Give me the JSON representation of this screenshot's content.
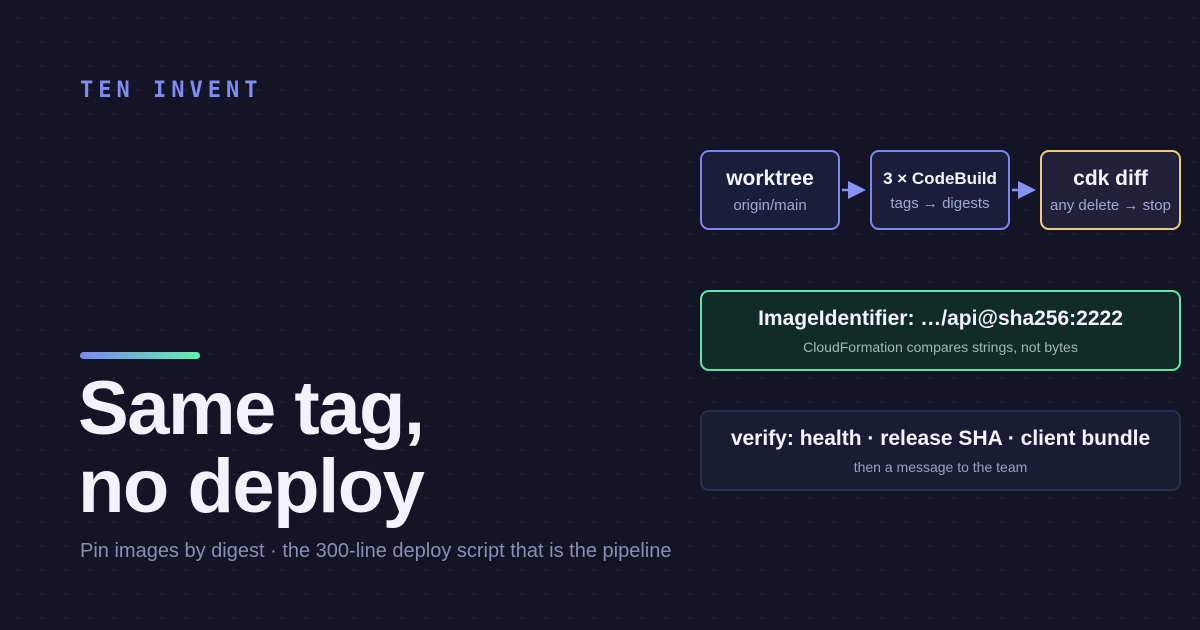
{
  "brand": "TEN INVENT",
  "headline": {
    "line1": "Same tag,",
    "line2": "no deploy"
  },
  "subtitle": "Pin images by digest · the 300-line deploy script that is the pipeline",
  "pipeline": {
    "nodes": [
      {
        "title": "worktree",
        "sub": "origin/main"
      },
      {
        "title": "3 × CodeBuild",
        "sub": "tags → digests"
      },
      {
        "title": "cdk diff",
        "sub": "any delete → stop"
      }
    ]
  },
  "image_panel": {
    "title": "ImageIdentifier: …/api@sha256:2222",
    "sub": "CloudFormation compares strings, not bytes"
  },
  "verify_panel": {
    "title": "verify: health · release SHA · client bundle",
    "sub": "then a message to the team"
  },
  "colors": {
    "background": "#131526",
    "brand": "#7f8cf0",
    "node_border": "#7d87f0",
    "warning_border": "#f1c97a",
    "success_border": "#5fe7a4",
    "accent_gradient_start": "#7b88f2",
    "accent_gradient_end": "#5ff2ad"
  }
}
